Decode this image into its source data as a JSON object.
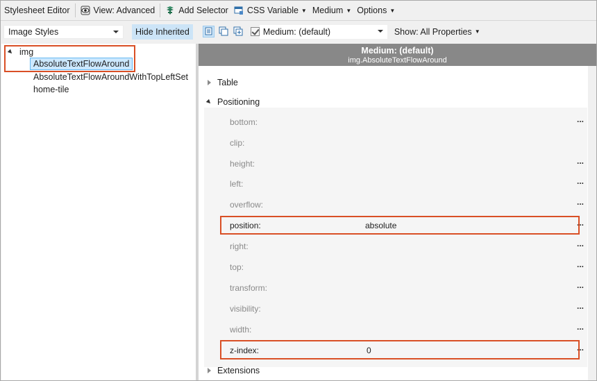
{
  "toolbar1": {
    "title": "Stylesheet Editor",
    "view_label": "View: Advanced",
    "add_selector_label": "Add Selector",
    "css_variable_label": "CSS Variable",
    "medium_menu_label": "Medium",
    "options_label": "Options"
  },
  "toolbar2": {
    "stylesheet_combo_value": "Image Styles",
    "hide_inherited_label": "Hide Inherited",
    "medium_combo_value": "Medium: (default)",
    "show_label": "Show: All Properties"
  },
  "tree": {
    "root": "img",
    "items": [
      "AbsoluteTextFlowAround",
      "AbsoluteTextFlowAroundWithTopLeftSet",
      "home-tile"
    ]
  },
  "properties_panel": {
    "header_title": "Medium: (default)",
    "header_subtitle": "img.AbsoluteTextFlowAround",
    "sections": [
      "Table",
      "Positioning",
      "Extensions"
    ],
    "more_label": "...",
    "positioning_props": [
      {
        "name": "bottom:",
        "value": ""
      },
      {
        "name": "clip:",
        "value": ""
      },
      {
        "name": "height:",
        "value": ""
      },
      {
        "name": "left:",
        "value": ""
      },
      {
        "name": "overflow:",
        "value": ""
      },
      {
        "name": "position:",
        "value": "absolute"
      },
      {
        "name": "right:",
        "value": ""
      },
      {
        "name": "top:",
        "value": ""
      },
      {
        "name": "transform:",
        "value": ""
      },
      {
        "name": "visibility:",
        "value": ""
      },
      {
        "name": "width:",
        "value": ""
      },
      {
        "name": "z-index:",
        "value": "0"
      }
    ]
  },
  "colors": {
    "highlight_box": "#d94f25",
    "selection_fill": "#cce8ff",
    "panel_header": "#888888"
  }
}
